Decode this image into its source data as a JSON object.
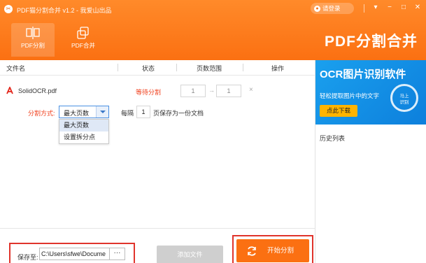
{
  "titlebar": {
    "logo_glyph": "✂",
    "title": "PDF猫分割合并 v1.2 - 我爱山出品",
    "login_label": "请登录",
    "window_buttons": [
      "▾",
      "−",
      "□",
      "✕"
    ]
  },
  "nav": {
    "tabs": [
      {
        "label": "PDF分割",
        "icon": "split-icon",
        "active": true
      },
      {
        "label": "PDF合并",
        "icon": "merge-icon",
        "active": false
      }
    ],
    "brand": "PDF分割合并"
  },
  "table": {
    "headers": [
      "文件名",
      "状态",
      "页数范围",
      "操作"
    ]
  },
  "file_row": {
    "name": "SolidOCR.pdf",
    "status": "等待分割",
    "range_from": "1",
    "range_arrow": "→",
    "range_to": "1",
    "delete": "×"
  },
  "split": {
    "label": "分割方式:",
    "selected": "最大页数",
    "per_prefix": "每隔",
    "per_value": "1",
    "per_suffix": "页保存为一份文档",
    "options": [
      "最大页数",
      "设置拆分点"
    ]
  },
  "ad": {
    "title": "OCR图片识别软件",
    "subtitle": "轻松提取图片中的文字",
    "button": "点此下载",
    "badge": "马上\n识别"
  },
  "history": {
    "label": "历史列表"
  },
  "bottom": {
    "save_to_label": "保存至:",
    "path": "C:\\Users\\sfwe\\Docume",
    "browse": "···",
    "add_file": "添加文件",
    "start": "开始分割"
  },
  "colors": {
    "accent": "#fb7012",
    "status_red": "#f0411e",
    "highlight_border": "#e0342c",
    "ad_blue": "#1aa0ee"
  }
}
